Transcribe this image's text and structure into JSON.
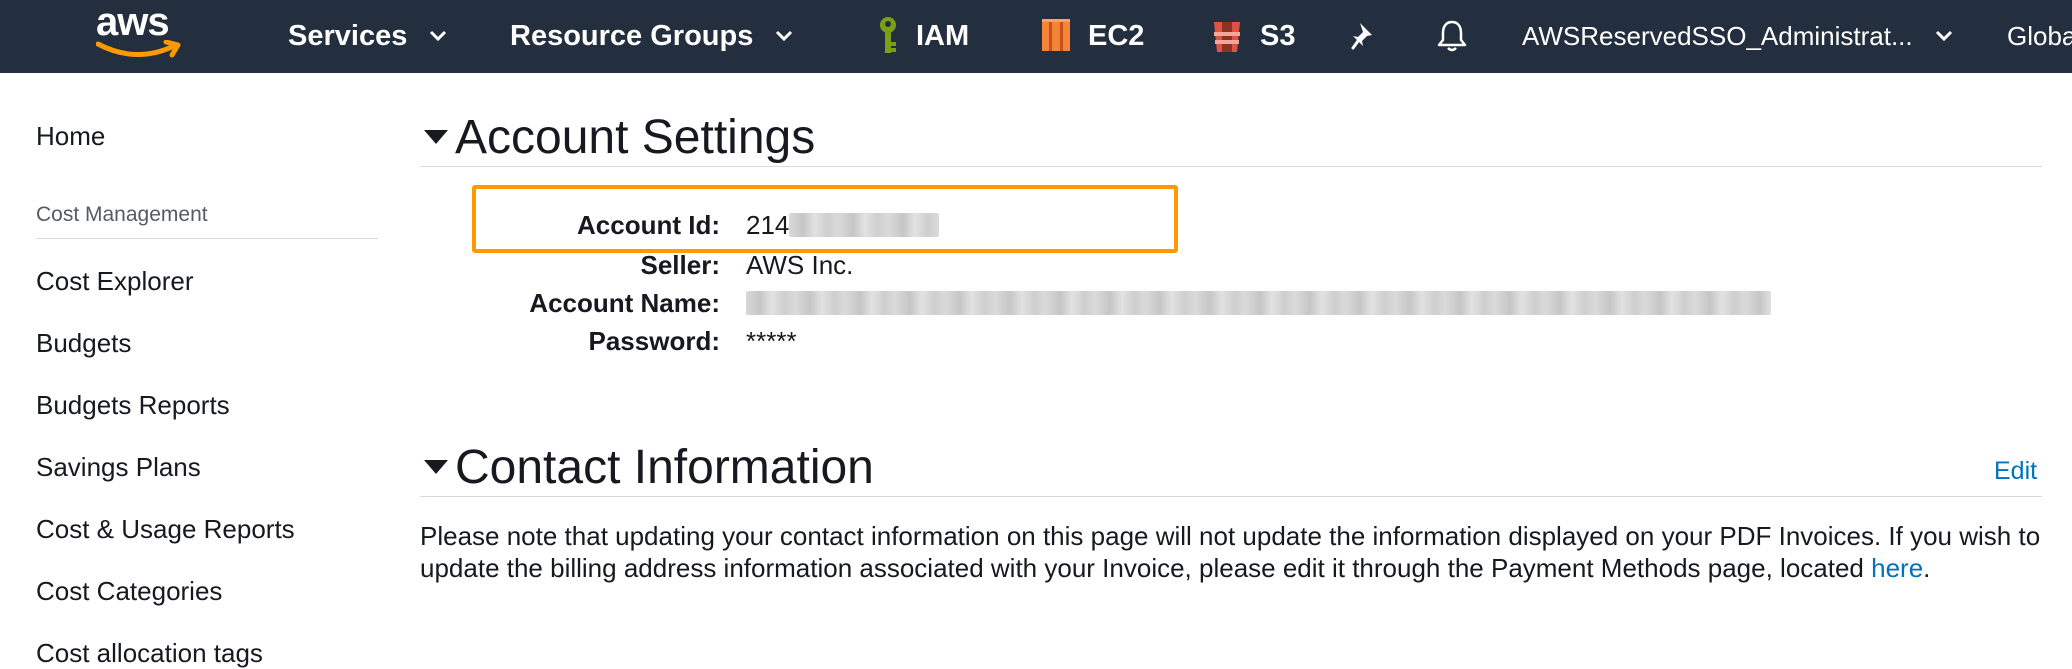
{
  "topnav": {
    "logo_text": "aws",
    "services_label": "Services",
    "resource_groups_label": "Resource Groups",
    "pinned": [
      {
        "label": "IAM",
        "icon": "iam-key-icon"
      },
      {
        "label": "EC2",
        "icon": "ec2-icon"
      },
      {
        "label": "S3",
        "icon": "s3-bucket-icon"
      }
    ],
    "account_label": "AWSReservedSSO_Administrat...",
    "region_label": "Globa",
    "colors": {
      "bar": "#232f3e",
      "accent": "#ff9900"
    }
  },
  "sidebar": {
    "home_label": "Home",
    "section_heading": "Cost Management",
    "items": [
      "Cost Explorer",
      "Budgets",
      "Budgets Reports",
      "Savings Plans",
      "Cost & Usage Reports",
      "Cost Categories",
      "Cost allocation tags"
    ]
  },
  "account_settings": {
    "title": "Account Settings",
    "account_id_label": "Account Id:",
    "account_id_value": "214",
    "seller_label": "Seller:",
    "seller_value": "AWS Inc.",
    "account_name_label": "Account Name:",
    "password_label": "Password:",
    "password_value": "*****"
  },
  "contact_information": {
    "title": "Contact Information",
    "edit_label": "Edit",
    "note_text": "Please note that updating your contact information on this page will not update the information displayed on your PDF Invoices. If you wish to update the billing address information associated with your Invoice, please edit it through the Payment Methods page, located ",
    "note_link": "here",
    "note_end": "."
  }
}
